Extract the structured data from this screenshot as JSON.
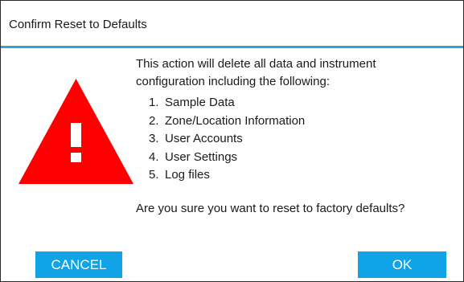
{
  "dialog": {
    "title": "Confirm Reset to Defaults",
    "accent_color": "#2aa6d6",
    "icon": "warning-triangle-icon",
    "icon_color": "#ff0000",
    "message_line_1": "This action will delete all data and instrument",
    "message_line_2": "configuration including the following:",
    "items": [
      {
        "number": "1.",
        "label": "Sample Data"
      },
      {
        "number": "2.",
        "label": "Zone/Location Information"
      },
      {
        "number": "3.",
        "label": "User Accounts"
      },
      {
        "number": "4.",
        "label": "User Settings"
      },
      {
        "number": "5.",
        "label": "Log files"
      }
    ],
    "question": "Are you sure you want to reset to factory defaults?",
    "buttons": {
      "cancel_label": "CANCEL",
      "ok_label": "OK",
      "color": "#10a3e6"
    }
  }
}
